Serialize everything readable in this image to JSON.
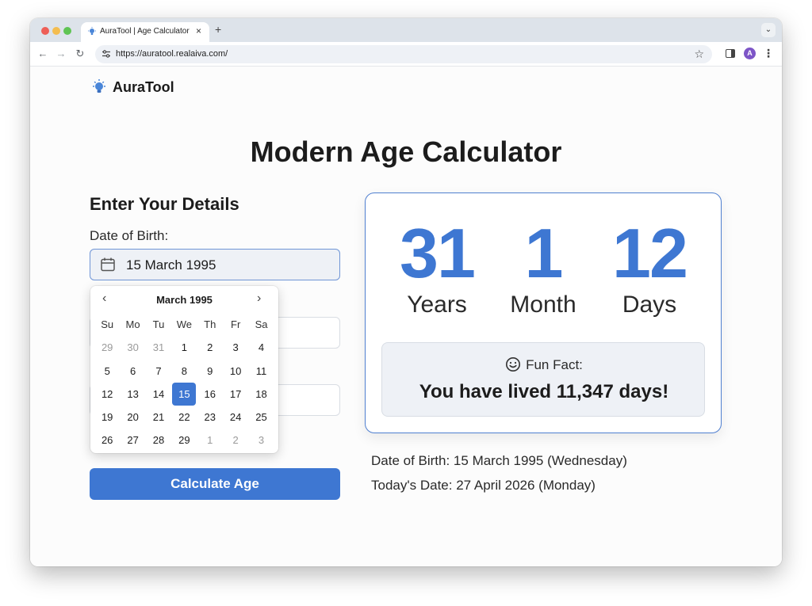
{
  "browser": {
    "tab_title": "AuraTool | Age Calculator",
    "tab_close": "×",
    "new_tab": "+",
    "dropdown": "⌄",
    "url": "https://auratool.realaiva.com/",
    "nav_back": "←",
    "nav_forward": "→",
    "nav_reload": "↻",
    "bookmark": "☆",
    "avatar_initial": "A",
    "menu": "⋮"
  },
  "header": {
    "logo_text": "AuraTool",
    "logo_icon": "lightbulb-icon"
  },
  "page": {
    "title": "Modern Age Calculator"
  },
  "form": {
    "section_title": "Enter Your Details",
    "dob_label": "Date of Birth:",
    "dob_value": "15 March 1995",
    "calculate_label": "Calculate Age"
  },
  "calendar": {
    "month_label": "March 1995",
    "prev": "‹",
    "next": "›",
    "weekdays": [
      "Su",
      "Mo",
      "Tu",
      "We",
      "Th",
      "Fr",
      "Sa"
    ],
    "weeks": [
      [
        {
          "d": "29",
          "out": true
        },
        {
          "d": "30",
          "out": true
        },
        {
          "d": "31",
          "out": true
        },
        {
          "d": "1"
        },
        {
          "d": "2"
        },
        {
          "d": "3"
        },
        {
          "d": "4"
        }
      ],
      [
        {
          "d": "5"
        },
        {
          "d": "6"
        },
        {
          "d": "7"
        },
        {
          "d": "8"
        },
        {
          "d": "9"
        },
        {
          "d": "10"
        },
        {
          "d": "11"
        }
      ],
      [
        {
          "d": "12"
        },
        {
          "d": "13"
        },
        {
          "d": "14"
        },
        {
          "d": "15",
          "selected": true
        },
        {
          "d": "16"
        },
        {
          "d": "17"
        },
        {
          "d": "18"
        }
      ],
      [
        {
          "d": "19"
        },
        {
          "d": "20"
        },
        {
          "d": "21"
        },
        {
          "d": "22"
        },
        {
          "d": "23"
        },
        {
          "d": "24"
        },
        {
          "d": "25"
        }
      ],
      [
        {
          "d": "26"
        },
        {
          "d": "27"
        },
        {
          "d": "28"
        },
        {
          "d": "29"
        },
        {
          "d": "1",
          "out": true
        },
        {
          "d": "2",
          "out": true
        },
        {
          "d": "3",
          "out": true
        }
      ]
    ]
  },
  "result": {
    "years": "31",
    "years_label": "Years",
    "months": "1",
    "months_label": "Month",
    "days": "12",
    "days_label": "Days",
    "fact_title": "Fun Fact:",
    "fact_text": "You have lived 11,347 days!",
    "dob_line": "Date of Birth: 15 March 1995 (Wednesday)",
    "today_line": "Today's Date: 27 April 2026 (Monday)"
  },
  "colors": {
    "accent": "#3e77d2",
    "card_border": "#4f7fd0"
  }
}
